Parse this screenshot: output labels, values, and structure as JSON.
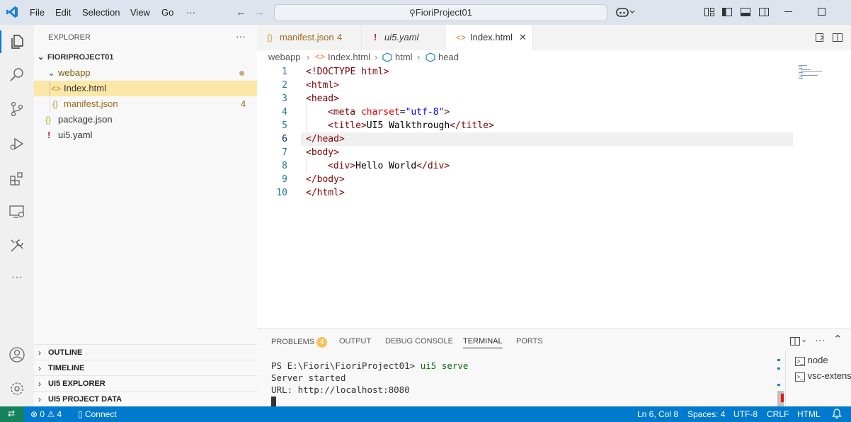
{
  "menu": {
    "file": "File",
    "edit": "Edit",
    "selection": "Selection",
    "view": "View",
    "go": "Go",
    "more": "···"
  },
  "search": {
    "text": "FioriProject01"
  },
  "explorer": {
    "header": "EXPLORER",
    "project": "FIORIPROJECT01",
    "tree": [
      {
        "label": "webapp",
        "badge": ""
      },
      {
        "label": "Index.html",
        "badge": ""
      },
      {
        "label": "manifest.json",
        "badge": "4"
      },
      {
        "label": "package.json",
        "badge": ""
      },
      {
        "label": "ui5.yaml",
        "badge": ""
      }
    ],
    "sections": [
      "OUTLINE",
      "TIMELINE",
      "UI5 EXPLORER",
      "UI5 PROJECT DATA"
    ]
  },
  "tabs": [
    {
      "label": "manifest.json",
      "badge": "4"
    },
    {
      "label": "ui5.yaml"
    },
    {
      "label": "Index.html"
    }
  ],
  "breadcrumb": {
    "folder": "webapp",
    "file": "Index.html",
    "node1": "html",
    "node2": "head"
  },
  "code": {
    "line_numbers": [
      "1",
      "2",
      "3",
      "4",
      "5",
      "6",
      "7",
      "8",
      "9",
      "10"
    ],
    "doctype": "<!DOCTYPE html>",
    "html_open": "<html>",
    "head_open": "<head>",
    "meta_open": "<meta",
    "meta_attr": "charset",
    "meta_eq": "=",
    "meta_val": "\"utf-8\"",
    "meta_close": ">",
    "title_open": "<title>",
    "title_text": "UI5 Walkthrough",
    "title_close": "</title>",
    "head_close": "</head>",
    "body_open": "<body>",
    "div_open": "<div>",
    "div_text": "Hello World",
    "div_close": "</div>",
    "body_close": "</body>",
    "html_close": "</html>"
  },
  "panel": {
    "tabs": {
      "problems": "PROBLEMS",
      "problems_count": "4",
      "output": "OUTPUT",
      "debug": "DEBUG CONSOLE",
      "terminal": "TERMINAL",
      "ports": "PORTS"
    },
    "terminal_lines": [
      "PS E:\\Fiori\\FioriProject01> ",
      "Server started",
      "URL: http://localhost:8080"
    ],
    "terminal_cmd": "ui5 serve",
    "terminal_list": [
      "node",
      "vsc-extens"
    ]
  },
  "status": {
    "errors": "0",
    "warnings": "4",
    "connect": "Connect",
    "position": "Ln 6, Col 8",
    "spaces": "Spaces: 4",
    "encoding": "UTF-8",
    "eol": "CRLF",
    "language": "HTML"
  },
  "colors": {
    "accent": "#007acc",
    "selection_row": "#fbe8a6",
    "title_bar": "#dde4ee"
  }
}
